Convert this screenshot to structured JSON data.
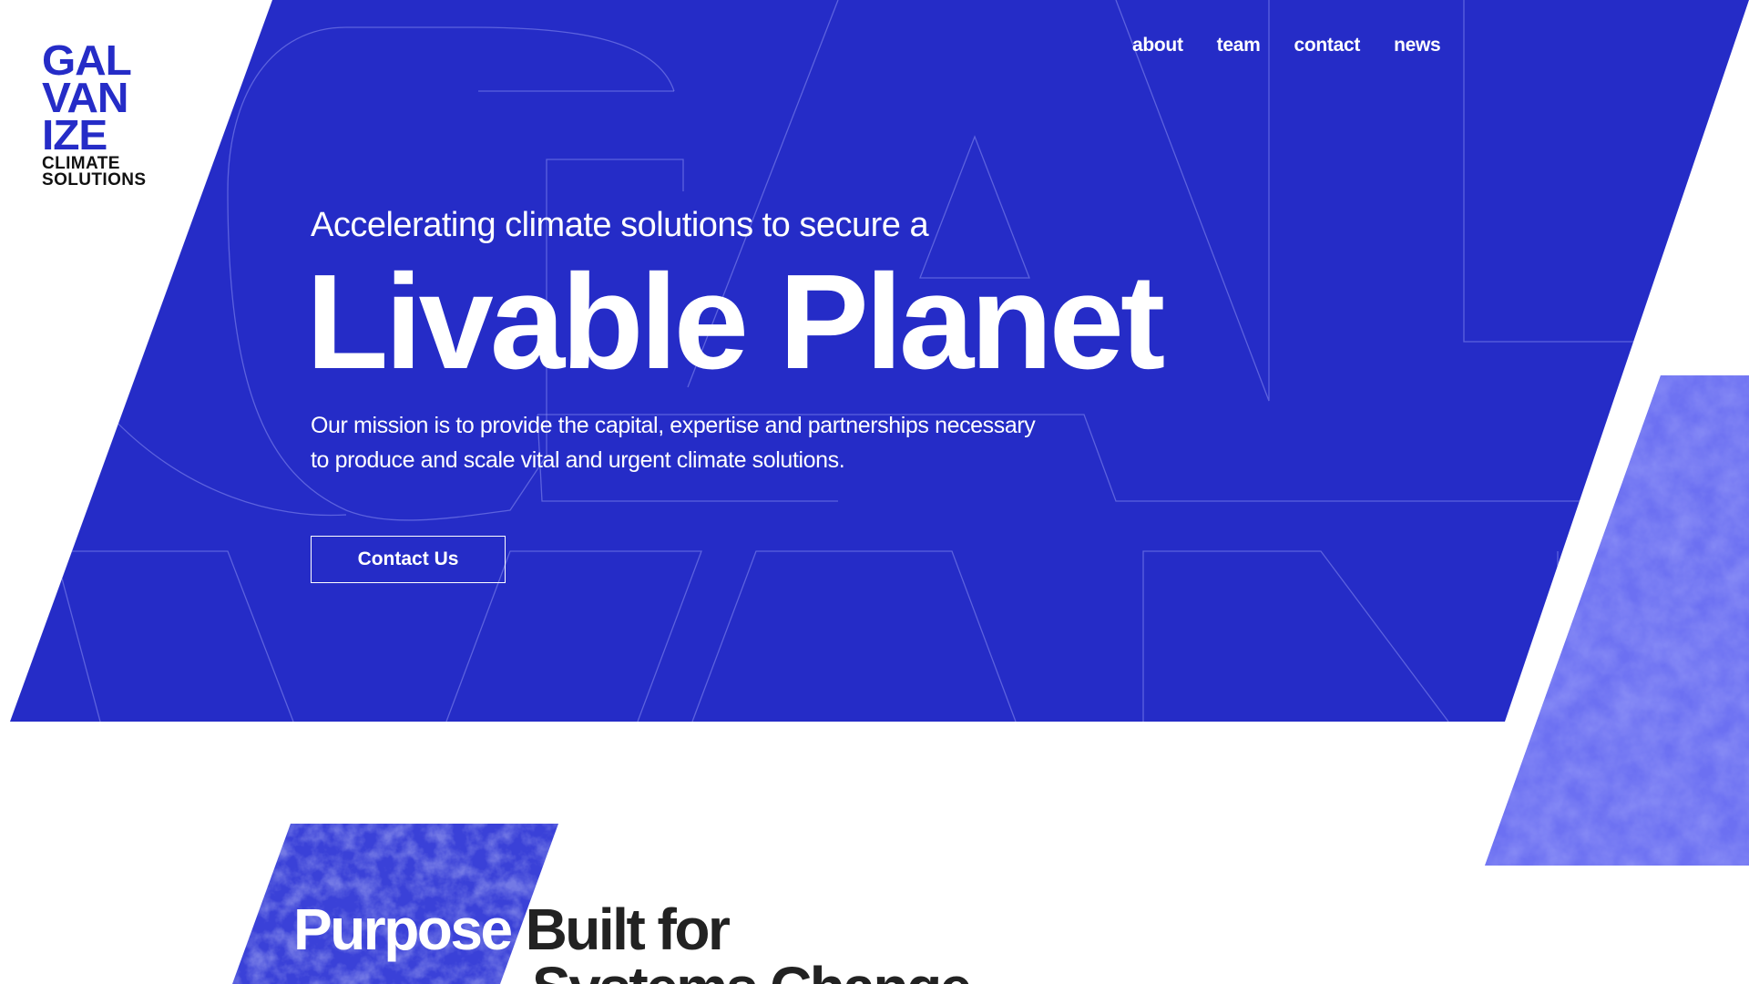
{
  "brand": {
    "logo_lines": [
      "GAL",
      "VAN",
      "IZE"
    ],
    "logo_sub": [
      "CLIMATE",
      "SOLUTIONS"
    ],
    "colors": {
      "primary_blue": "#252cc7",
      "texture_blue": "#5a5ff0",
      "dark_text": "#222222",
      "white": "#ffffff"
    }
  },
  "nav": {
    "items": [
      {
        "label": "about"
      },
      {
        "label": "team"
      },
      {
        "label": "contact"
      },
      {
        "label": "news"
      }
    ]
  },
  "hero": {
    "eyebrow": "Accelerating climate solutions to secure a",
    "headline": "Livable Planet",
    "mission": "Our mission is to provide the capital, expertise and partnerships necessary to produce and scale vital and urgent climate solutions.",
    "cta_label": "Contact Us"
  },
  "section": {
    "heading_word1": "Purpose",
    "heading_word2": "Built for",
    "heading_line2": "Systems Change"
  }
}
